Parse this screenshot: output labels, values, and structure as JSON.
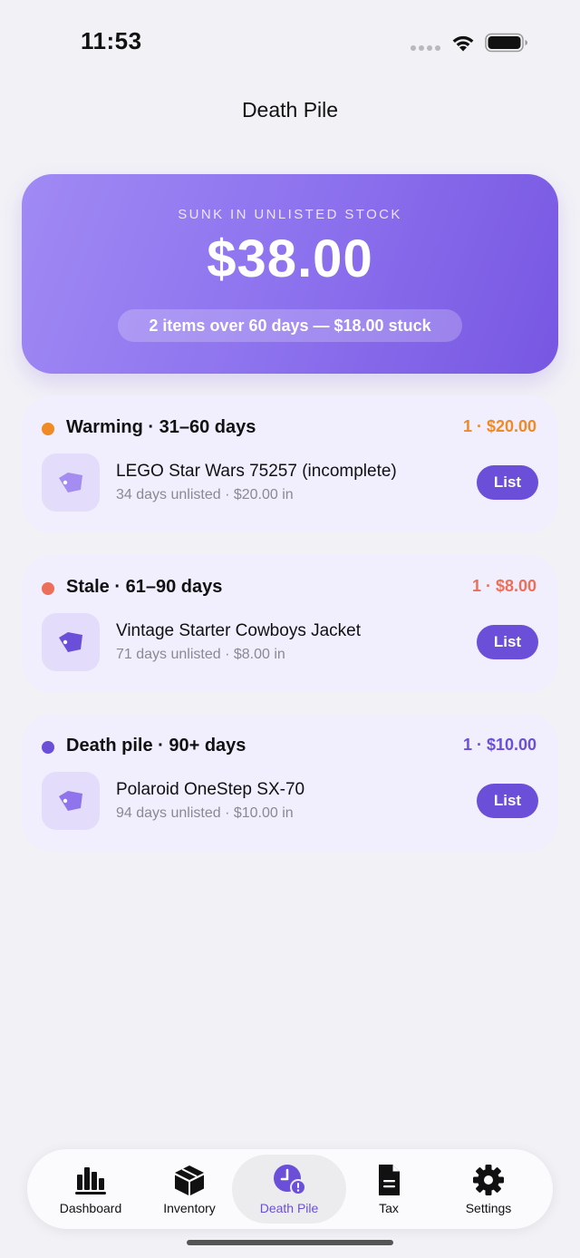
{
  "status_bar": {
    "time": "11:53"
  },
  "header": {
    "title": "Death Pile"
  },
  "hero": {
    "label": "SUNK IN UNLISTED STOCK",
    "amount": "$38.00",
    "pill_text": "2 items over 60 days — $18.00 stuck"
  },
  "groups": [
    {
      "title": "Warming · 31–60 days",
      "summary": "1 · $20.00",
      "color": "#f08a24",
      "item": {
        "name": "LEGO Star Wars 75257 (incomplete)",
        "meta": "34 days unlisted · $20.00 in",
        "action": "List",
        "icon": "price-tag-icon"
      }
    },
    {
      "title": "Stale · 61–90 days",
      "summary": "1 · $8.00",
      "color": "#ec6f5a",
      "item": {
        "name": "Vintage Starter Cowboys Jacket",
        "meta": "71 days unlisted · $8.00 in",
        "action": "List",
        "icon": "price-tag-icon"
      }
    },
    {
      "title": "Death pile · 90+ days",
      "summary": "1 · $10.00",
      "color": "#6b4fd8",
      "item": {
        "name": "Polaroid OneStep SX-70",
        "meta": "94 days unlisted · $10.00 in",
        "action": "List",
        "icon": "price-tag-icon"
      }
    }
  ],
  "tab_bar": {
    "tabs": [
      {
        "label": "Dashboard",
        "icon": "bar-chart-icon"
      },
      {
        "label": "Inventory",
        "icon": "box-icon"
      },
      {
        "label": "Death Pile",
        "icon": "clock-alert-icon"
      },
      {
        "label": "Tax",
        "icon": "document-icon"
      },
      {
        "label": "Settings",
        "icon": "gear-icon"
      }
    ],
    "active": "Death Pile"
  },
  "colors": {
    "accent": "#6b4fd8",
    "warming": "#f08a24",
    "stale": "#ec6f5a",
    "death_pile": "#6b4fd8",
    "background": "#f2f1f6"
  }
}
